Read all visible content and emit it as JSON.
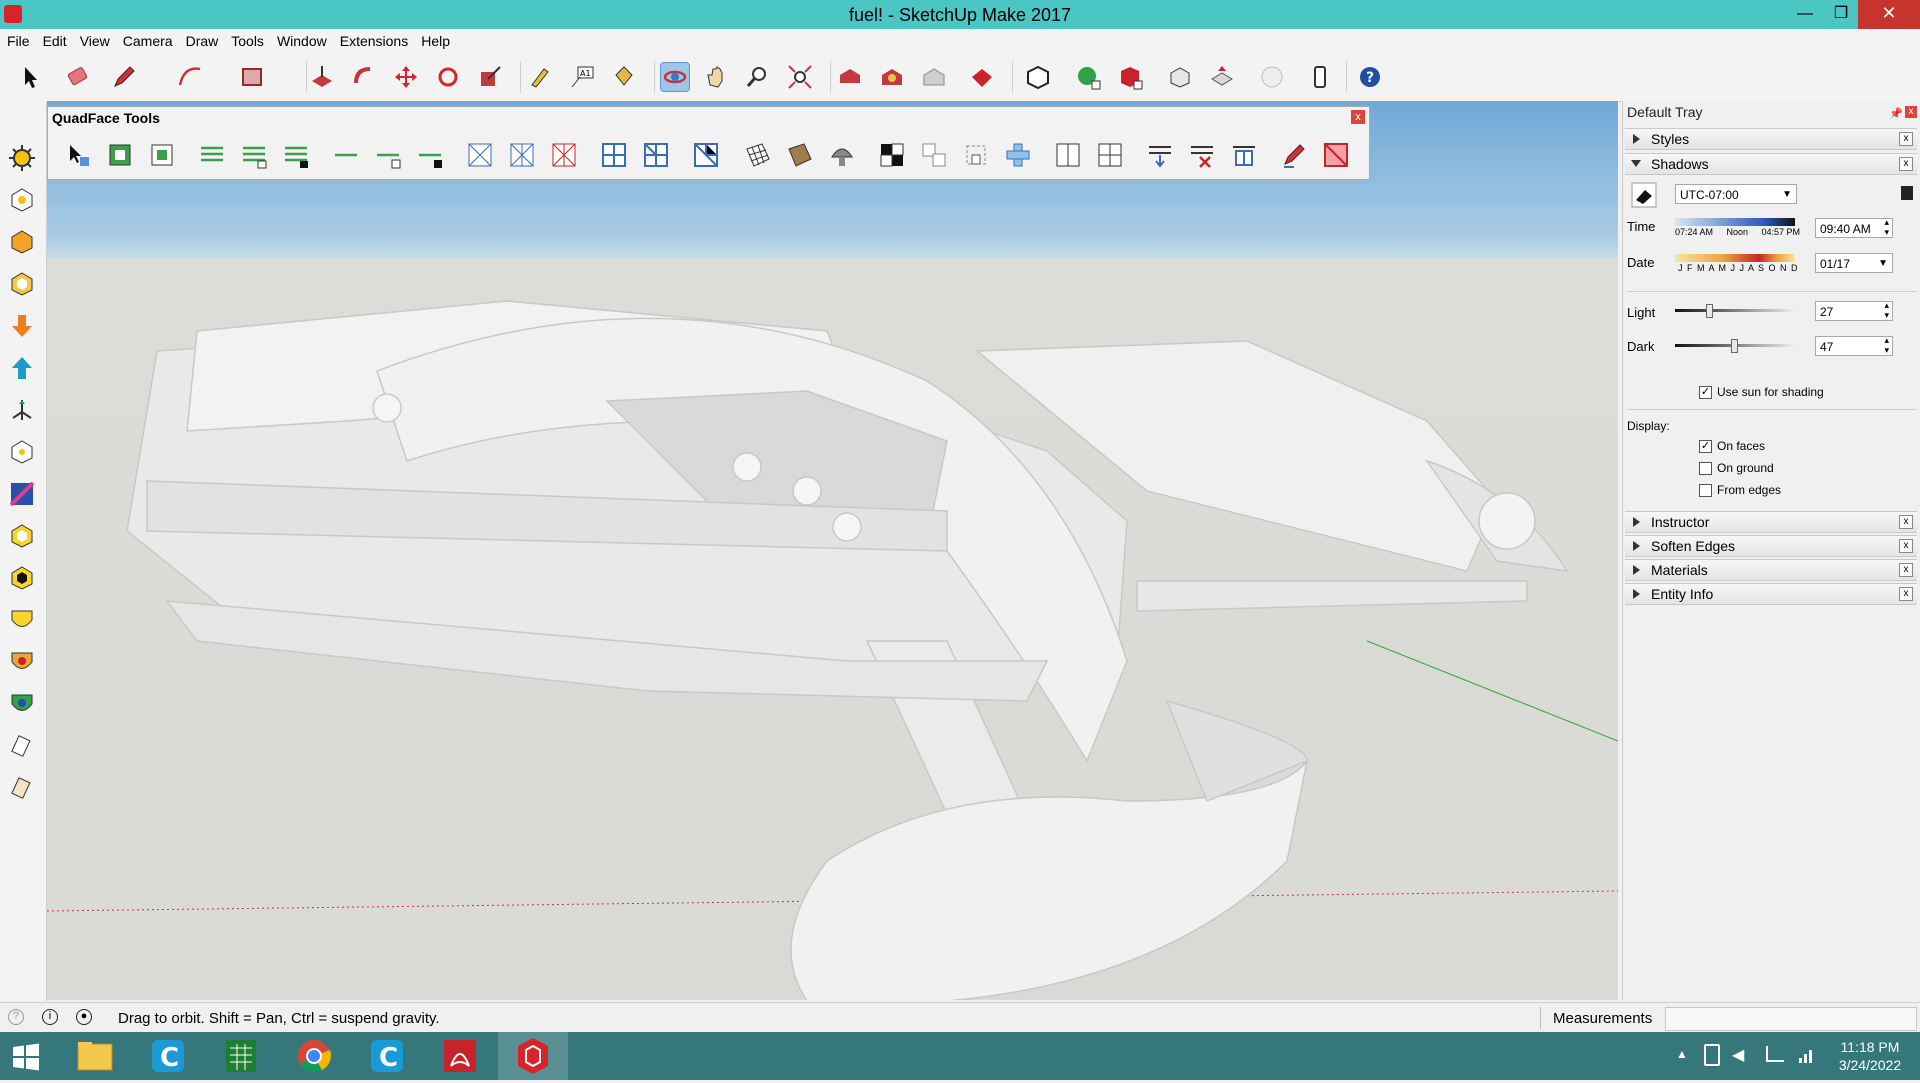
{
  "window": {
    "title": "fuel! - SketchUp Make 2017",
    "controls": {
      "minimize": "—",
      "maximize": "❐",
      "close": "✕"
    }
  },
  "menu": [
    "File",
    "Edit",
    "View",
    "Camera",
    "Draw",
    "Tools",
    "Window",
    "Extensions",
    "Help"
  ],
  "quadface": {
    "title": "QuadFace Tools",
    "close": "x"
  },
  "tray": {
    "title": "Default Tray",
    "panels": {
      "styles": "Styles",
      "shadows": "Shadows",
      "instructor": "Instructor",
      "soften_edges": "Soften Edges",
      "materials": "Materials",
      "entity_info": "Entity Info"
    },
    "shadows": {
      "timezone": "UTC-07:00",
      "time_label": "Time",
      "time_ticks": [
        "07:24 AM",
        "Noon",
        "04:57 PM"
      ],
      "time_value": "09:40 AM",
      "date_label": "Date",
      "date_months": "J F M A M J J A S O N D",
      "date_value": "01/17",
      "light_label": "Light",
      "light_value": "27",
      "dark_label": "Dark",
      "dark_value": "47",
      "use_sun": "Use sun for shading",
      "use_sun_checked": true,
      "display_label": "Display:",
      "on_faces": "On faces",
      "on_faces_checked": true,
      "on_ground": "On ground",
      "on_ground_checked": false,
      "from_edges": "From edges",
      "from_edges_checked": false
    }
  },
  "status": {
    "message": "Drag to orbit. Shift = Pan, Ctrl = suspend gravity.",
    "measurements_label": "Measurements",
    "measurements_value": ""
  },
  "taskbar": {
    "time": "11:18 PM",
    "date": "3/24/2022"
  },
  "colors": {
    "titlebar": "#4ac6c4",
    "taskbar": "#36777c",
    "sky": "#8fbde0",
    "ground": "#d9d9d5",
    "model": "#ededed"
  }
}
